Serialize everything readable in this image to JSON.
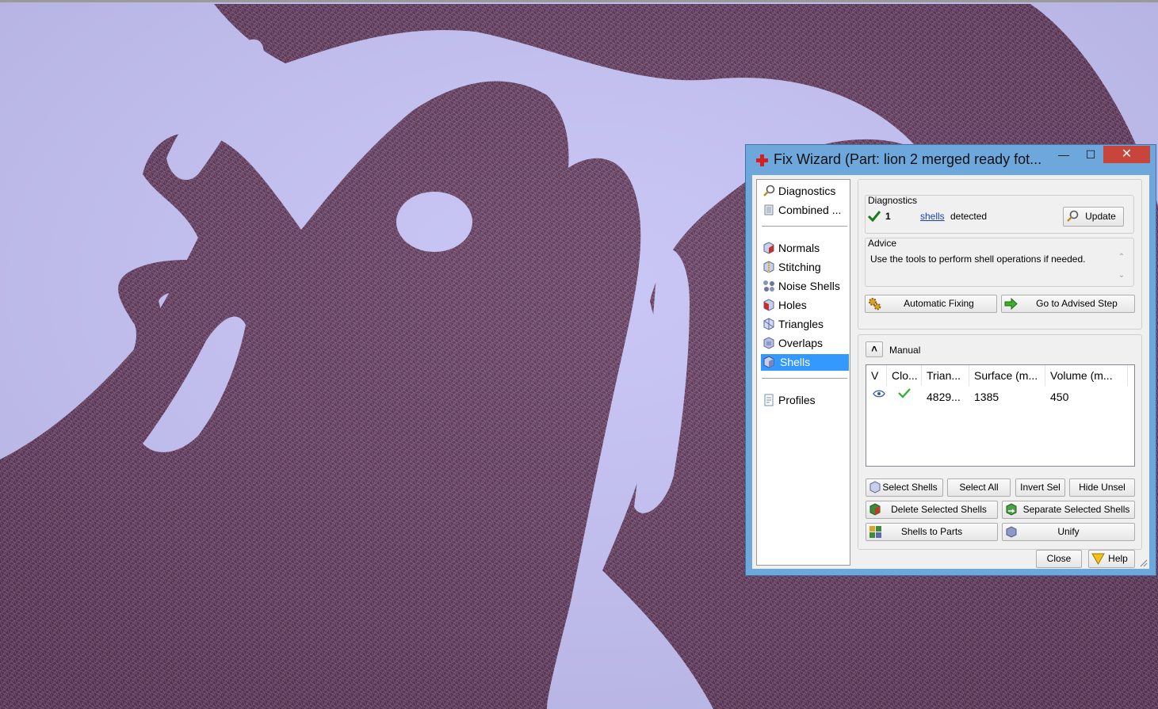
{
  "window": {
    "title": "Fix Wizard (Part: lion 2 merged ready fot...",
    "minimize": "—",
    "maximize": "☐",
    "close": "✕"
  },
  "nav": {
    "top_items": [
      {
        "label": "Diagnostics",
        "icon": "magnifier-icon"
      },
      {
        "label": "Combined ...",
        "icon": "combined-icon"
      }
    ],
    "items": [
      {
        "label": "Normals",
        "icon": "normals-icon"
      },
      {
        "label": "Stitching",
        "icon": "stitching-icon"
      },
      {
        "label": "Noise Shells",
        "icon": "noise-shells-icon"
      },
      {
        "label": "Holes",
        "icon": "holes-icon"
      },
      {
        "label": "Triangles",
        "icon": "triangles-icon"
      },
      {
        "label": "Overlaps",
        "icon": "overlaps-icon"
      },
      {
        "label": "Shells",
        "icon": "shells-icon",
        "selected": true
      }
    ],
    "bottom_items": [
      {
        "label": "Profiles",
        "icon": "profiles-icon"
      }
    ]
  },
  "diagnostics": {
    "heading": "Diagnostics",
    "count": "1",
    "link": "shells",
    "suffix": "detected",
    "update_label": "Update"
  },
  "advice": {
    "heading": "Advice",
    "text": "Use the tools to perform shell operations if needed."
  },
  "actions": {
    "automatic_fixing": "Automatic Fixing",
    "advised_step": "Go to Advised Step"
  },
  "manual": {
    "heading": "Manual",
    "collapse": "˄"
  },
  "table": {
    "columns": [
      "V",
      "Clo...",
      "Trian...",
      "Surface (m...",
      "Volume (m..."
    ],
    "rows": [
      {
        "triangles": "4829...",
        "surface": "1385",
        "volume": "450"
      }
    ]
  },
  "buttons": {
    "select_shells": "Select Shells",
    "select_all": "Select All",
    "invert_sel": "Invert Sel",
    "hide_unsel": "Hide Unsel",
    "delete_selected": "Delete Selected Shells",
    "separate_selected": "Separate Selected Shells",
    "shells_to_parts": "Shells to Parts",
    "unify": "Unify",
    "close": "Close",
    "help": "Help"
  },
  "colors": {
    "viewport_bg": "#c6c3f6",
    "mesh": "#5a3356",
    "title_bar": "#6ea7dc",
    "close_button": "#c7453a",
    "selection": "#3399ff"
  }
}
